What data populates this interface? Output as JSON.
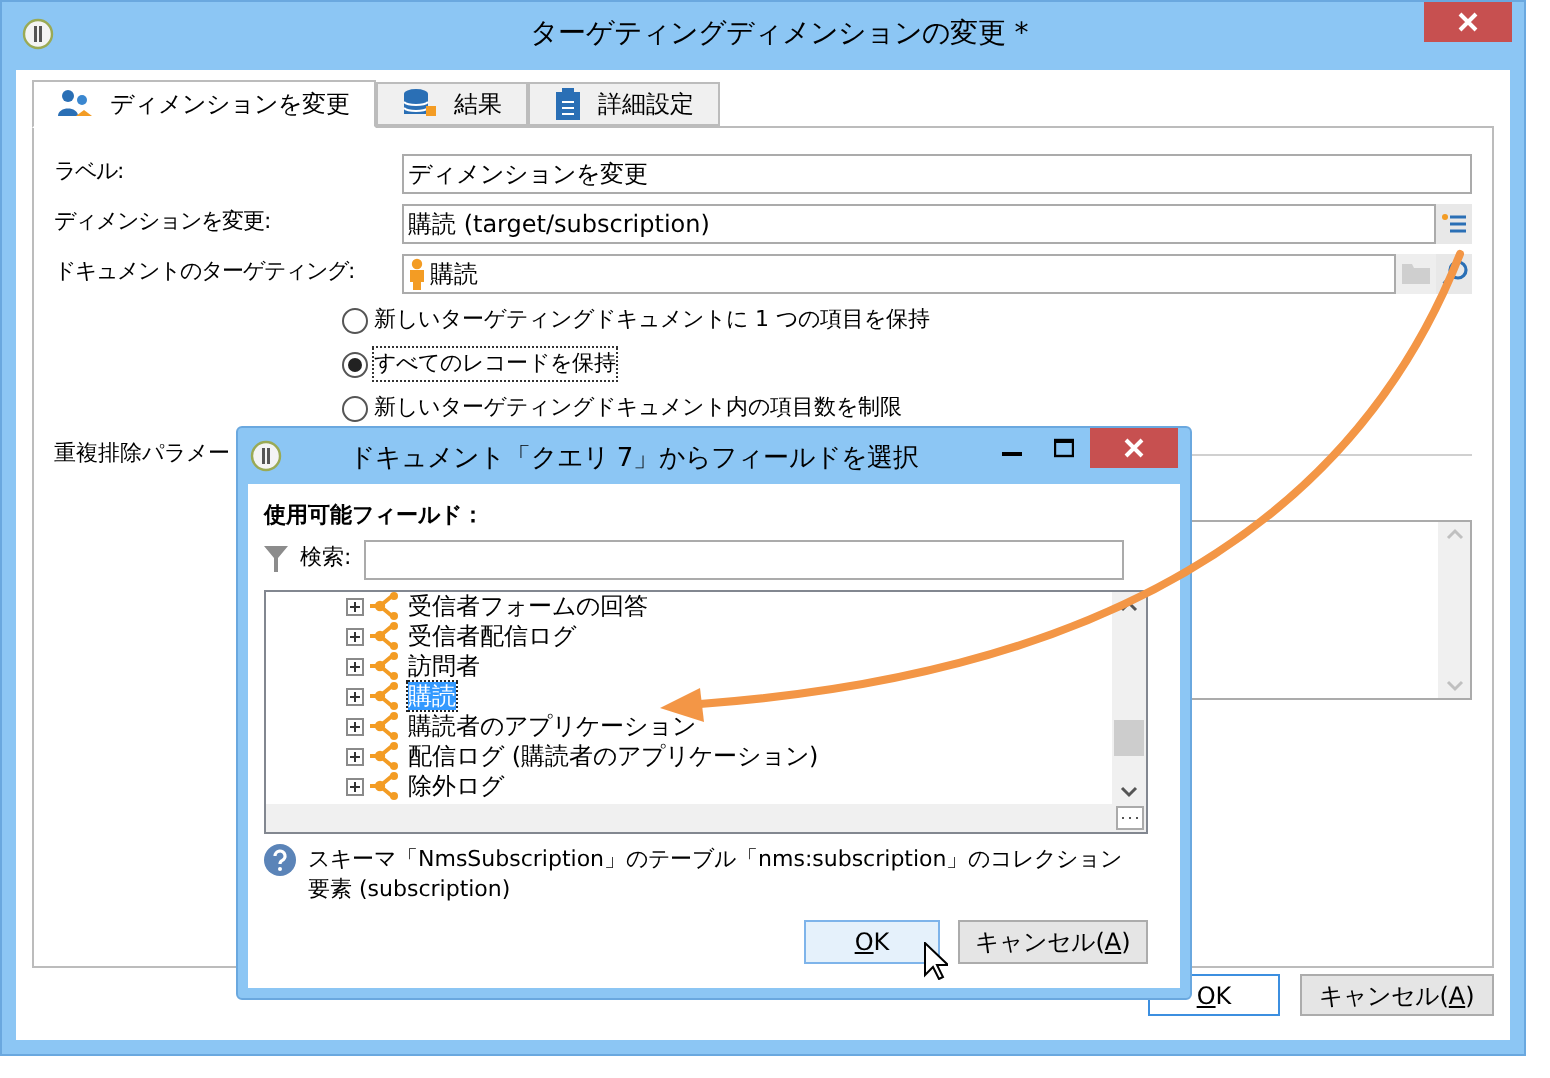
{
  "window": {
    "title": "ターゲティングディメンションの変更 *"
  },
  "tabs": [
    {
      "label": "ディメンションを変更",
      "selected": true
    },
    {
      "label": "結果",
      "selected": false
    },
    {
      "label": "詳細設定",
      "selected": false
    }
  ],
  "fields": [
    {
      "kind": "text",
      "label": "ラベル:",
      "value": "ディメンションを変更"
    },
    {
      "kind": "picker",
      "label": "ディメンションを変更:",
      "value": "購読 (target/subscription)"
    },
    {
      "kind": "targeting",
      "label": "ドキュメントのターゲティング:",
      "value": "購読"
    }
  ],
  "radio_options": [
    {
      "label": "新しいターゲティングドキュメントに 1 つの項目を保持",
      "selected": false
    },
    {
      "label": "すべてのレコードを保持",
      "selected": true
    },
    {
      "label": "新しいターゲティングドキュメント内の項目数を制限",
      "selected": false
    }
  ],
  "dedup_section": {
    "label": "重複排除パラメー"
  },
  "buttons": [
    {
      "mnemonic": "O",
      "after": "K"
    },
    {
      "before": "キャンセル(",
      "mnemonic": "A",
      "after": ")"
    }
  ],
  "dialog": {
    "title": "ドキュメント「クエリ 7」からフィールドを選択",
    "section_label": "使用可能フィールド：",
    "search_label": "検索:",
    "tree_items": [
      {
        "label": "受信者フォームの回答",
        "selected": false
      },
      {
        "label": "受信者配信ログ",
        "selected": false
      },
      {
        "label": "訪問者",
        "selected": false
      },
      {
        "label": "購読",
        "selected": true
      },
      {
        "label": "購読者のアプリケーション",
        "selected": false
      },
      {
        "label": "配信ログ (購読者のアプリケーション)",
        "selected": false
      },
      {
        "label": "除外ログ",
        "selected": false
      }
    ],
    "help_text": "スキーマ「NmsSubscription」のテーブル「nms:subscription」のコレクション要素 (subscription)",
    "buttons": [
      {
        "mnemonic": "O",
        "after": "K"
      },
      {
        "before": "キャンセル(",
        "mnemonic": "A",
        "after": ")"
      }
    ]
  }
}
